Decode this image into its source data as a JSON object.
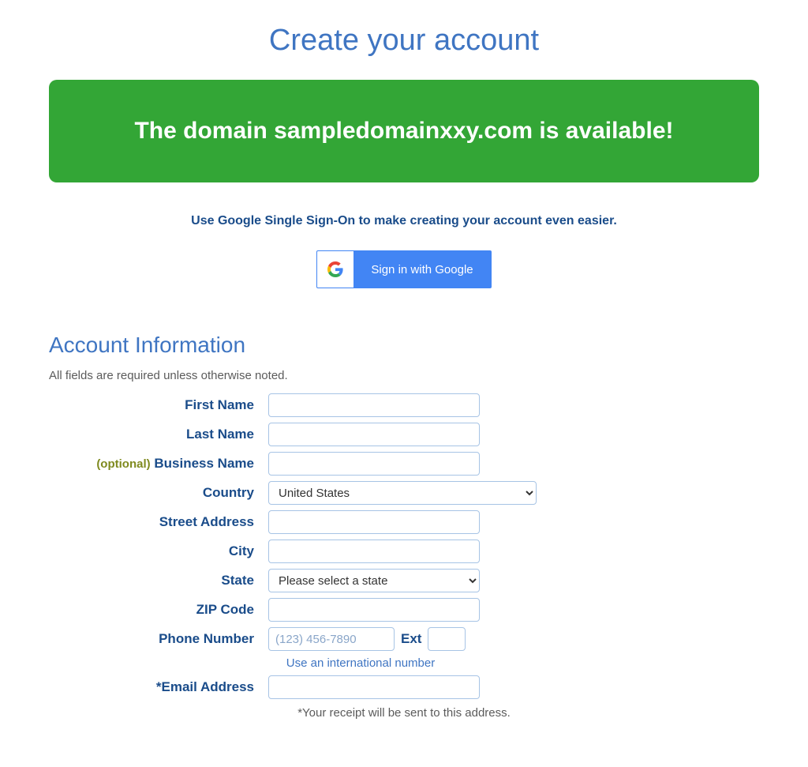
{
  "page": {
    "title": "Create your account"
  },
  "banner": {
    "text": "The domain sampledomainxxy.com is available!"
  },
  "sso": {
    "prompt": "Use Google Single Sign-On to make creating your account even easier.",
    "button_label": "Sign in with Google"
  },
  "section": {
    "title": "Account Information",
    "required_note": "All fields are required unless otherwise noted."
  },
  "form": {
    "first_name": {
      "label": "First Name",
      "value": ""
    },
    "last_name": {
      "label": "Last Name",
      "value": ""
    },
    "business_name": {
      "optional_tag": "(optional)",
      "label": "Business Name",
      "value": ""
    },
    "country": {
      "label": "Country",
      "selected": "United States"
    },
    "street": {
      "label": "Street Address",
      "value": ""
    },
    "city": {
      "label": "City",
      "value": ""
    },
    "state": {
      "label": "State",
      "selected": "Please select a state"
    },
    "zip": {
      "label": "ZIP Code",
      "value": ""
    },
    "phone": {
      "label": "Phone Number",
      "placeholder": "(123) 456-7890",
      "value": "",
      "ext_label": "Ext",
      "ext_value": "",
      "intl_link": "Use an international number"
    },
    "email": {
      "label": "*Email Address",
      "value": "",
      "receipt_note": "*Your receipt will be sent to this address."
    }
  }
}
